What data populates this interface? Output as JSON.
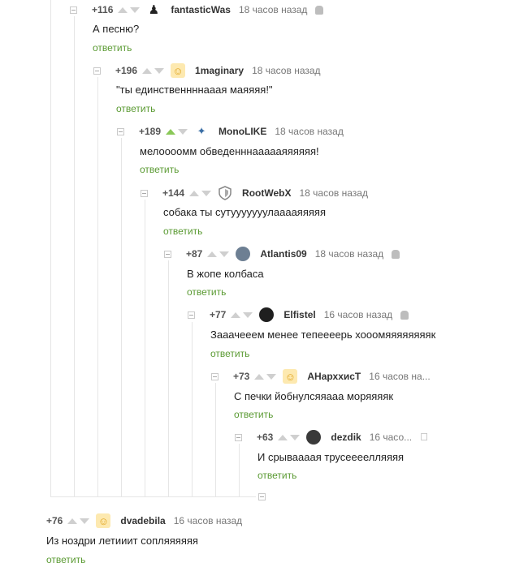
{
  "reply_label": "ответить",
  "colors": {
    "reply": "#5a9a32",
    "upvote_active": "#8ac858",
    "line": "#e6e6e6"
  },
  "comments": [
    {
      "rating": "+116",
      "user": "fantasticWas",
      "time": "18 часов назад",
      "device": "android-icon",
      "avatar": "person-silhouette",
      "text": "А песню?",
      "up_active": false
    },
    {
      "rating": "+196",
      "user": "1maginary",
      "time": "18 часов назад",
      "device": "",
      "avatar": "default-avatar",
      "text": "\"ты единственнннааая маяяяя!\"",
      "up_active": false
    },
    {
      "rating": "+189",
      "user": "MonoLIKE",
      "time": "18 часов назад",
      "device": "",
      "avatar": "bird-avatar",
      "text": "мелоооомм обведенннаааааяяяяяя!",
      "up_active": true
    },
    {
      "rating": "+144",
      "user": "RootWebX",
      "time": "18 часов назад",
      "device": "",
      "avatar": "shield-avatar",
      "text": "собака ты сутууууууулааааяяяяя",
      "up_active": false
    },
    {
      "rating": "+87",
      "user": "Atlantis09",
      "time": "18 часов назад",
      "device": "android-icon",
      "avatar": "photo-avatar",
      "text": "В жопе колбаса",
      "up_active": false
    },
    {
      "rating": "+77",
      "user": "Elfistel",
      "time": "16 часов назад",
      "device": "android-icon",
      "avatar": "dark-avatar",
      "text": "Зааачееем менее тепеееерь хооомяяяяяяяяк",
      "up_active": false
    },
    {
      "rating": "+73",
      "user": "АНархxисТ",
      "time": "16 часов на...",
      "device": "",
      "avatar": "default-avatar",
      "text": "С печки йобнулсяяааа моряяяяк",
      "up_active": false
    },
    {
      "rating": "+63",
      "user": "dezdik",
      "time": "16 часо...",
      "device": "apple-icon",
      "avatar": "face-avatar",
      "text": "И срываааая трусеееелляяяя",
      "up_active": false
    },
    {
      "rating": "+76",
      "user": "dvadebila",
      "time": "16 часов назад",
      "device": "",
      "avatar": "default-avatar",
      "text": "Из ноздри летииит сопляяяяяя",
      "up_active": false
    }
  ]
}
